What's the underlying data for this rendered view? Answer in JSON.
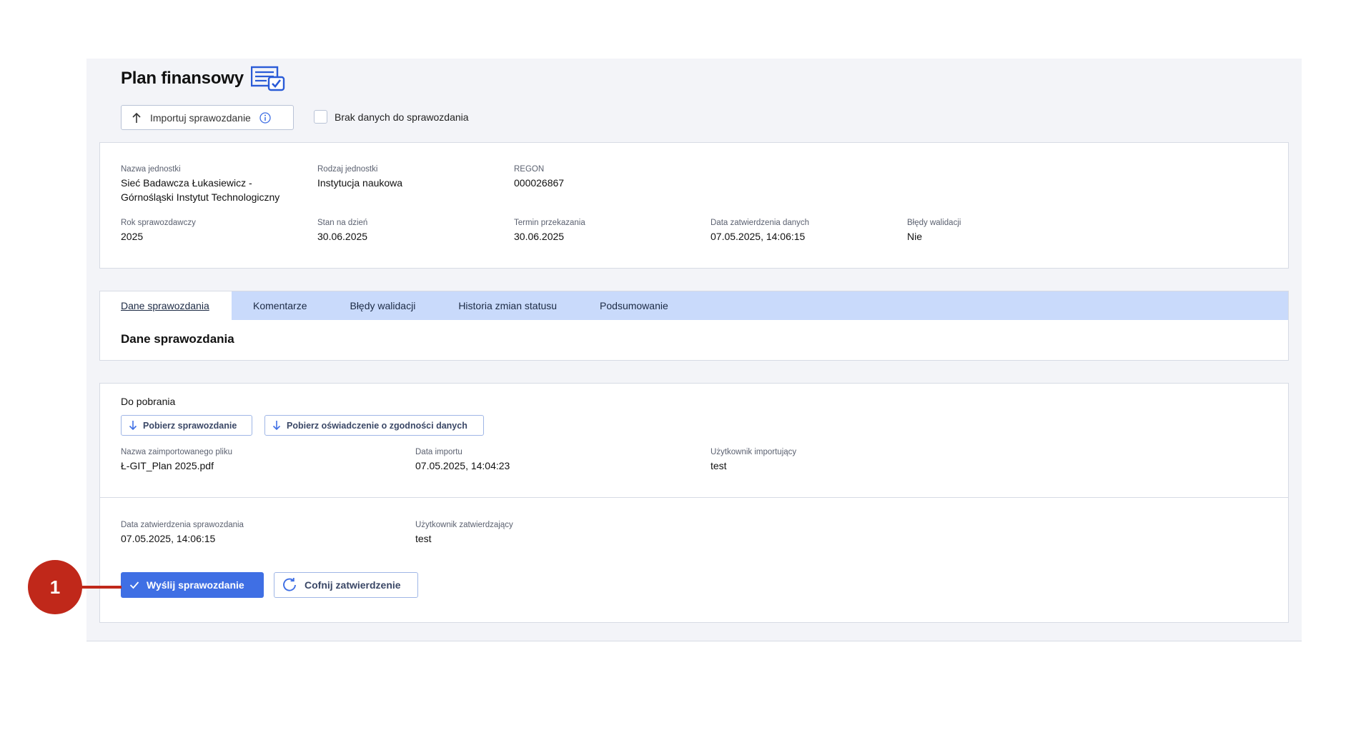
{
  "header": {
    "title": "Plan finansowy",
    "title_icon": "report-check-icon",
    "import_label": "Importuj sprawozdanie",
    "no_data_label": "Brak danych do sprawozdania"
  },
  "unit_info": {
    "nazwa_label": "Nazwa jednostki",
    "nazwa_line1": "Sieć Badawcza Łukasiewicz -",
    "nazwa_line2": "Górnośląski Instytut Technologiczny",
    "rodzaj_label": "Rodzaj jednostki",
    "rodzaj_value": "Instytucja naukowa",
    "regon_label": "REGON",
    "regon_value": "000026867",
    "rok_label": "Rok sprawozdawczy",
    "rok_value": "2025",
    "stan_label": "Stan na dzień",
    "stan_value": "30.06.2025",
    "termin_label": "Termin przekazania",
    "termin_value": "30.06.2025",
    "zatw_label": "Data zatwierdzenia danych",
    "zatw_value": "07.05.2025, 14:06:15",
    "bledy_label": "Błędy walidacji",
    "bledy_value": "Nie"
  },
  "tabs": [
    {
      "label": "Dane sprawozdania",
      "active": true
    },
    {
      "label": "Komentarze"
    },
    {
      "label": "Błędy walidacji"
    },
    {
      "label": "Historia zmian statusu"
    },
    {
      "label": "Podsumowanie"
    }
  ],
  "section_title": "Dane sprawozdania",
  "downloads": {
    "label": "Do pobrania",
    "btn_report": "Pobierz sprawozdanie",
    "btn_statement": "Pobierz oświadczenie o zgodności danych"
  },
  "import_info": {
    "file_label": "Nazwa zaimportowanego pliku",
    "file_value": "Ł-GIT_Plan 2025.pdf",
    "date_label": "Data importu",
    "date_value": "07.05.2025, 14:04:23",
    "user_label": "Użytkownik importujący",
    "user_value": "test"
  },
  "approval_info": {
    "date_label": "Data zatwierdzenia sprawozdania",
    "date_value": "07.05.2025, 14:06:15",
    "user_label": "Użytkownik zatwierdzający",
    "user_value": "test"
  },
  "actions": {
    "send_label": "Wyślij sprawozdanie",
    "undo_label": "Cofnij zatwierdzenie"
  },
  "annotation": {
    "number": "1"
  },
  "colors": {
    "accent": "#3f6fe4",
    "tabbar": "#c9dafb",
    "marker": "#c0281a"
  }
}
